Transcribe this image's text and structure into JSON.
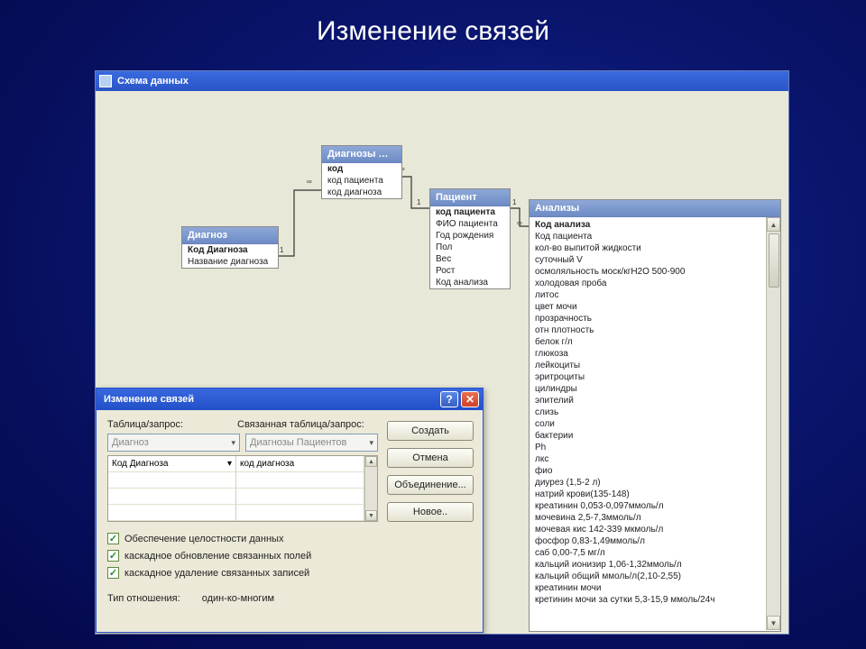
{
  "slide": {
    "title": "Изменение связей"
  },
  "schema_window": {
    "title": "Схема данных"
  },
  "tables": {
    "diagnoz": {
      "title": "Диагноз",
      "fields": [
        {
          "name": "Код Диагноза",
          "pk": true
        },
        {
          "name": "Название диагноза",
          "pk": false
        }
      ]
    },
    "diagnozy": {
      "title": "Диагнозы …",
      "fields": [
        {
          "name": "код",
          "pk": true
        },
        {
          "name": "код пациента",
          "pk": false
        },
        {
          "name": "код диагноза",
          "pk": false
        }
      ]
    },
    "patient": {
      "title": "Пациент",
      "fields": [
        {
          "name": "код пациента",
          "pk": true
        },
        {
          "name": "ФИО пациента",
          "pk": false
        },
        {
          "name": "Год рождения",
          "pk": false
        },
        {
          "name": "Пол",
          "pk": false
        },
        {
          "name": "Вес",
          "pk": false
        },
        {
          "name": "Рост",
          "pk": false
        },
        {
          "name": "Код анализа",
          "pk": false
        }
      ]
    },
    "analyzes": {
      "title": "Анализы",
      "fields": [
        "Код анализа",
        "Код пациента",
        "кол-во выпитой жидкости",
        "суточный V",
        "осмоляльность моск/кгH2O 500-900",
        "холодовая проба",
        "литос",
        "цвет мочи",
        "прозрачность",
        "отн плотность",
        "белок г/л",
        "глюкоза",
        "лейкоциты",
        "эритроциты",
        "цилиндры",
        "эпителий",
        "слизь",
        "соли",
        "бактерии",
        "Ph",
        "лкс",
        "фио",
        "диурез (1,5-2 л)",
        "натрий крови(135-148)",
        "креатинин 0,053-0,097ммоль/л",
        "мочевина 2,5-7,3ммоль/л",
        "мочевая кис 142-339 мкмоль/л",
        "фосфор 0,83-1,49ммоль/л",
        "саб 0,00-7,5 мг/л",
        "кальций ионизир 1,06-1,32ммоль/л",
        "кальций общий ммоль/л(2,10-2,55)",
        "креатинин мочи",
        "кретинин мочи за сутки 5,3-15,9 ммоль/24ч"
      ]
    }
  },
  "cardinality": {
    "one": "1",
    "many": "∞"
  },
  "dialog": {
    "title": "Изменение связей",
    "label_table": "Таблица/запрос:",
    "label_related": "Связанная таблица/запрос:",
    "combo_left": "Диагноз",
    "combo_right": "Диагнозы Пациентов",
    "field_left": "Код Диагноза",
    "field_right": "код диагноза",
    "check1": "Обеспечение целостности данных",
    "check2": "каскадное обновление связанных полей",
    "check3": "каскадное удаление связанных записей",
    "reltype_label": "Тип отношения:",
    "reltype_value": "один-ко-многим",
    "btn_create": "Создать",
    "btn_cancel": "Отмена",
    "btn_join": "Объединение...",
    "btn_new": "Новое.."
  }
}
